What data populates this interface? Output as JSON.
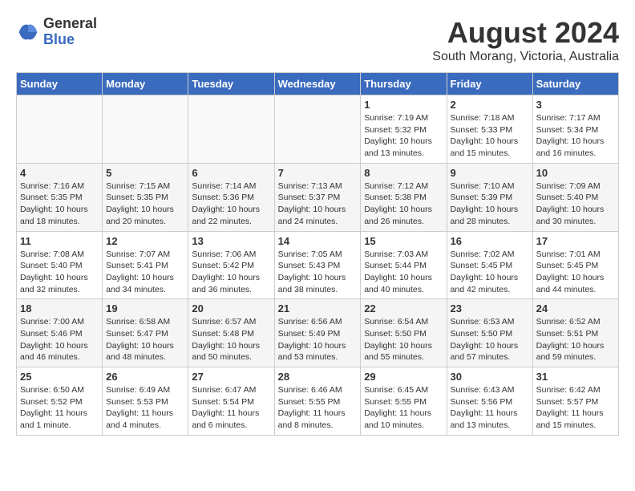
{
  "logo": {
    "general": "General",
    "blue": "Blue"
  },
  "title": {
    "month_year": "August 2024",
    "location": "South Morang, Victoria, Australia"
  },
  "days_of_week": [
    "Sunday",
    "Monday",
    "Tuesday",
    "Wednesday",
    "Thursday",
    "Friday",
    "Saturday"
  ],
  "weeks": [
    [
      {
        "day": "",
        "info": ""
      },
      {
        "day": "",
        "info": ""
      },
      {
        "day": "",
        "info": ""
      },
      {
        "day": "",
        "info": ""
      },
      {
        "day": "1",
        "info": "Sunrise: 7:19 AM\nSunset: 5:32 PM\nDaylight: 10 hours\nand 13 minutes."
      },
      {
        "day": "2",
        "info": "Sunrise: 7:18 AM\nSunset: 5:33 PM\nDaylight: 10 hours\nand 15 minutes."
      },
      {
        "day": "3",
        "info": "Sunrise: 7:17 AM\nSunset: 5:34 PM\nDaylight: 10 hours\nand 16 minutes."
      }
    ],
    [
      {
        "day": "4",
        "info": "Sunrise: 7:16 AM\nSunset: 5:35 PM\nDaylight: 10 hours\nand 18 minutes."
      },
      {
        "day": "5",
        "info": "Sunrise: 7:15 AM\nSunset: 5:35 PM\nDaylight: 10 hours\nand 20 minutes."
      },
      {
        "day": "6",
        "info": "Sunrise: 7:14 AM\nSunset: 5:36 PM\nDaylight: 10 hours\nand 22 minutes."
      },
      {
        "day": "7",
        "info": "Sunrise: 7:13 AM\nSunset: 5:37 PM\nDaylight: 10 hours\nand 24 minutes."
      },
      {
        "day": "8",
        "info": "Sunrise: 7:12 AM\nSunset: 5:38 PM\nDaylight: 10 hours\nand 26 minutes."
      },
      {
        "day": "9",
        "info": "Sunrise: 7:10 AM\nSunset: 5:39 PM\nDaylight: 10 hours\nand 28 minutes."
      },
      {
        "day": "10",
        "info": "Sunrise: 7:09 AM\nSunset: 5:40 PM\nDaylight: 10 hours\nand 30 minutes."
      }
    ],
    [
      {
        "day": "11",
        "info": "Sunrise: 7:08 AM\nSunset: 5:40 PM\nDaylight: 10 hours\nand 32 minutes."
      },
      {
        "day": "12",
        "info": "Sunrise: 7:07 AM\nSunset: 5:41 PM\nDaylight: 10 hours\nand 34 minutes."
      },
      {
        "day": "13",
        "info": "Sunrise: 7:06 AM\nSunset: 5:42 PM\nDaylight: 10 hours\nand 36 minutes."
      },
      {
        "day": "14",
        "info": "Sunrise: 7:05 AM\nSunset: 5:43 PM\nDaylight: 10 hours\nand 38 minutes."
      },
      {
        "day": "15",
        "info": "Sunrise: 7:03 AM\nSunset: 5:44 PM\nDaylight: 10 hours\nand 40 minutes."
      },
      {
        "day": "16",
        "info": "Sunrise: 7:02 AM\nSunset: 5:45 PM\nDaylight: 10 hours\nand 42 minutes."
      },
      {
        "day": "17",
        "info": "Sunrise: 7:01 AM\nSunset: 5:45 PM\nDaylight: 10 hours\nand 44 minutes."
      }
    ],
    [
      {
        "day": "18",
        "info": "Sunrise: 7:00 AM\nSunset: 5:46 PM\nDaylight: 10 hours\nand 46 minutes."
      },
      {
        "day": "19",
        "info": "Sunrise: 6:58 AM\nSunset: 5:47 PM\nDaylight: 10 hours\nand 48 minutes."
      },
      {
        "day": "20",
        "info": "Sunrise: 6:57 AM\nSunset: 5:48 PM\nDaylight: 10 hours\nand 50 minutes."
      },
      {
        "day": "21",
        "info": "Sunrise: 6:56 AM\nSunset: 5:49 PM\nDaylight: 10 hours\nand 53 minutes."
      },
      {
        "day": "22",
        "info": "Sunrise: 6:54 AM\nSunset: 5:50 PM\nDaylight: 10 hours\nand 55 minutes."
      },
      {
        "day": "23",
        "info": "Sunrise: 6:53 AM\nSunset: 5:50 PM\nDaylight: 10 hours\nand 57 minutes."
      },
      {
        "day": "24",
        "info": "Sunrise: 6:52 AM\nSunset: 5:51 PM\nDaylight: 10 hours\nand 59 minutes."
      }
    ],
    [
      {
        "day": "25",
        "info": "Sunrise: 6:50 AM\nSunset: 5:52 PM\nDaylight: 11 hours\nand 1 minute."
      },
      {
        "day": "26",
        "info": "Sunrise: 6:49 AM\nSunset: 5:53 PM\nDaylight: 11 hours\nand 4 minutes."
      },
      {
        "day": "27",
        "info": "Sunrise: 6:47 AM\nSunset: 5:54 PM\nDaylight: 11 hours\nand 6 minutes."
      },
      {
        "day": "28",
        "info": "Sunrise: 6:46 AM\nSunset: 5:55 PM\nDaylight: 11 hours\nand 8 minutes."
      },
      {
        "day": "29",
        "info": "Sunrise: 6:45 AM\nSunset: 5:55 PM\nDaylight: 11 hours\nand 10 minutes."
      },
      {
        "day": "30",
        "info": "Sunrise: 6:43 AM\nSunset: 5:56 PM\nDaylight: 11 hours\nand 13 minutes."
      },
      {
        "day": "31",
        "info": "Sunrise: 6:42 AM\nSunset: 5:57 PM\nDaylight: 11 hours\nand 15 minutes."
      }
    ]
  ]
}
